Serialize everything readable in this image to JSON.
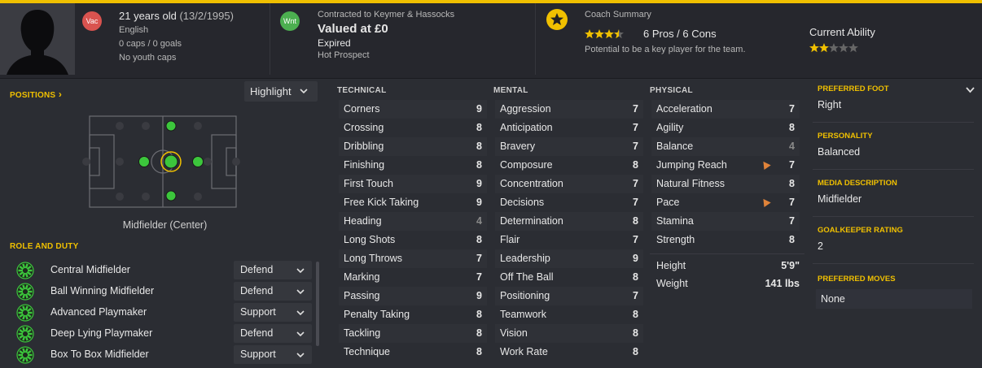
{
  "header": {
    "age": "21 years old",
    "dob": "(13/2/1995)",
    "nationality": "English",
    "caps": "0 caps / 0 goals",
    "youth_caps": "No youth caps",
    "vac_badge": "Vac",
    "wnt_badge": "Wnt",
    "contract": "Contracted to Keymer & Hassocks",
    "value": "Valued at £0",
    "contract_status": "Expired",
    "prospect": "Hot Prospect",
    "coach_title": "Coach Summary",
    "pros_cons": "6 Pros / 6 Cons",
    "potential_text": "Potential to be a key player for the team.",
    "current_ability_label": "Current Ability",
    "coach_stars": 3.5,
    "ability_stars": 2
  },
  "positions": {
    "label": "POSITIONS",
    "chevron": "›",
    "highlight_label": "Highlight",
    "position_name": "Midfielder (Center)"
  },
  "role_duty": {
    "label": "ROLE AND DUTY",
    "roles": [
      {
        "name": "Central Midfielder",
        "duty": "Defend"
      },
      {
        "name": "Ball Winning Midfielder",
        "duty": "Defend"
      },
      {
        "name": "Advanced Playmaker",
        "duty": "Support"
      },
      {
        "name": "Deep Lying Playmaker",
        "duty": "Defend"
      },
      {
        "name": "Box To Box Midfielder",
        "duty": "Support"
      }
    ]
  },
  "technical": {
    "header": "TECHNICAL",
    "attrs": [
      {
        "name": "Corners",
        "value": "9"
      },
      {
        "name": "Crossing",
        "value": "8"
      },
      {
        "name": "Dribbling",
        "value": "8"
      },
      {
        "name": "Finishing",
        "value": "8"
      },
      {
        "name": "First Touch",
        "value": "9"
      },
      {
        "name": "Free Kick Taking",
        "value": "9"
      },
      {
        "name": "Heading",
        "value": "4"
      },
      {
        "name": "Long Shots",
        "value": "8"
      },
      {
        "name": "Long Throws",
        "value": "7"
      },
      {
        "name": "Marking",
        "value": "7"
      },
      {
        "name": "Passing",
        "value": "9"
      },
      {
        "name": "Penalty Taking",
        "value": "8"
      },
      {
        "name": "Tackling",
        "value": "8"
      },
      {
        "name": "Technique",
        "value": "8"
      }
    ]
  },
  "mental": {
    "header": "MENTAL",
    "attrs": [
      {
        "name": "Aggression",
        "value": "7"
      },
      {
        "name": "Anticipation",
        "value": "7"
      },
      {
        "name": "Bravery",
        "value": "7"
      },
      {
        "name": "Composure",
        "value": "8"
      },
      {
        "name": "Concentration",
        "value": "7"
      },
      {
        "name": "Decisions",
        "value": "7"
      },
      {
        "name": "Determination",
        "value": "8"
      },
      {
        "name": "Flair",
        "value": "7"
      },
      {
        "name": "Leadership",
        "value": "9"
      },
      {
        "name": "Off The Ball",
        "value": "8"
      },
      {
        "name": "Positioning",
        "value": "7"
      },
      {
        "name": "Teamwork",
        "value": "8"
      },
      {
        "name": "Vision",
        "value": "8"
      },
      {
        "name": "Work Rate",
        "value": "8"
      }
    ]
  },
  "physical": {
    "header": "PHYSICAL",
    "attrs": [
      {
        "name": "Acceleration",
        "value": "7"
      },
      {
        "name": "Agility",
        "value": "8"
      },
      {
        "name": "Balance",
        "value": "4"
      },
      {
        "name": "Jumping Reach",
        "value": "7"
      },
      {
        "name": "Natural Fitness",
        "value": "8"
      },
      {
        "name": "Pace",
        "value": "7"
      },
      {
        "name": "Stamina",
        "value": "7"
      },
      {
        "name": "Strength",
        "value": "8"
      }
    ],
    "height_label": "Height",
    "height": "5'9\"",
    "weight_label": "Weight",
    "weight": "141 lbs"
  },
  "info": {
    "preferred_foot_label": "PREFERRED FOOT",
    "preferred_foot": "Right",
    "personality_label": "PERSONALITY",
    "personality": "Balanced",
    "media_label": "MEDIA DESCRIPTION",
    "media": "Midfielder",
    "gk_label": "GOALKEEPER RATING",
    "gk": "2",
    "moves_label": "PREFERRED MOVES",
    "moves": "None"
  },
  "colors": {
    "accent": "#f0c000",
    "green": "#3cc63c",
    "flame": "#e0833a",
    "vac": "#d9534f",
    "wnt": "#4caf50"
  }
}
